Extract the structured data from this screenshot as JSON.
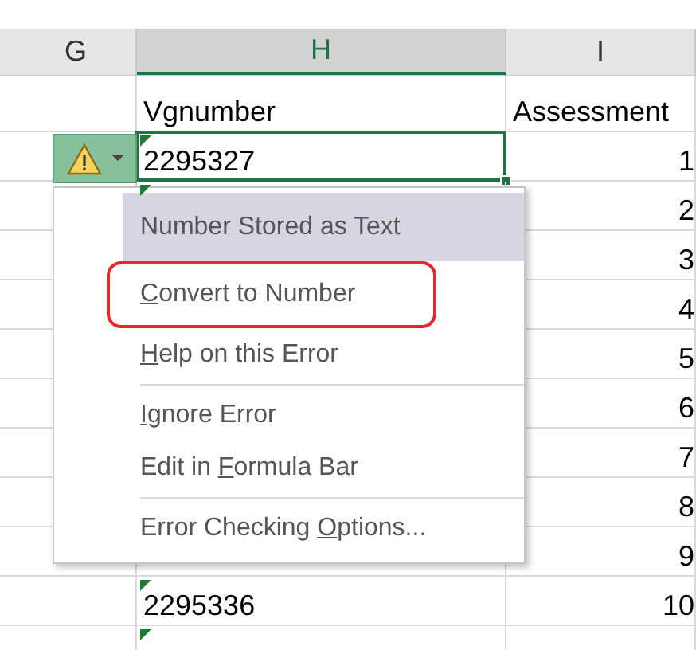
{
  "columns": [
    {
      "label": "G",
      "selected": false
    },
    {
      "label": "H",
      "selected": true
    },
    {
      "label": "I",
      "selected": false
    }
  ],
  "header_row": {
    "col_h": "Vgnumber",
    "col_i": "Assessment"
  },
  "rows": [
    {
      "col_h": "2295327",
      "col_i": "1",
      "selected": true,
      "error_flag": true
    },
    {
      "col_i": "2",
      "selected": false,
      "error_flag": true
    },
    {
      "col_i": "3",
      "selected": false
    },
    {
      "col_i": "4",
      "selected": false
    },
    {
      "col_i": "5",
      "selected": false
    },
    {
      "col_i": "6",
      "selected": false
    },
    {
      "col_i": "7",
      "selected": false
    },
    {
      "col_i": "8",
      "selected": false
    },
    {
      "col_i": "9",
      "selected": false
    },
    {
      "col_h": "2295336",
      "col_i": "10",
      "selected": false,
      "error_flag": true
    },
    {
      "selected": false,
      "error_flag": true
    }
  ],
  "menu": {
    "title": "Number Stored as Text",
    "items": [
      {
        "kind": "item",
        "key": "C",
        "after": "onvert to Number",
        "circled": true
      },
      {
        "kind": "item",
        "key": "H",
        "after": "elp on this Error",
        "circled": false
      },
      {
        "kind": "separator"
      },
      {
        "kind": "item",
        "key": "I",
        "after": "gnore Error",
        "circled": false
      },
      {
        "kind": "item",
        "before": "Edit in ",
        "key": "F",
        "after": "ormula Bar",
        "circled": false
      },
      {
        "kind": "separator"
      },
      {
        "kind": "item",
        "before": "Error Checking ",
        "key": "O",
        "after": "ptions...",
        "circled": false
      }
    ]
  }
}
